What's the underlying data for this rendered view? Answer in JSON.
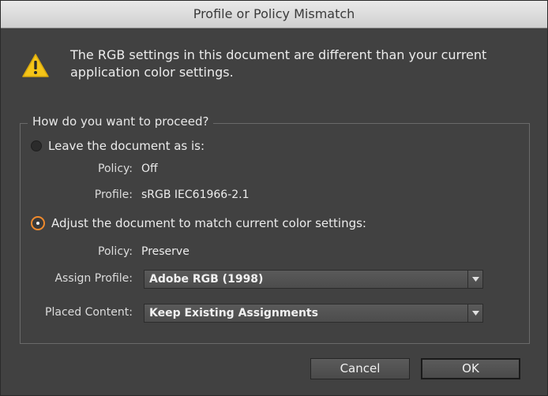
{
  "window": {
    "title": "Profile or Policy Mismatch"
  },
  "icons": {
    "warning": "warning-triangle-icon",
    "dropdown": "chevron-down-icon"
  },
  "message": "The RGB settings in this document are different than your current application color settings.",
  "group": {
    "legend": "How do you want to proceed?",
    "option1": {
      "label": "Leave the document as is:",
      "checked": false,
      "policy_label": "Policy:",
      "policy_value": "Off",
      "profile_label": "Profile:",
      "profile_value": "sRGB IEC61966-2.1"
    },
    "option2": {
      "label": "Adjust the document to match current color settings:",
      "checked": true,
      "policy_label": "Policy:",
      "policy_value": "Preserve",
      "assign_profile_label": "Assign Profile:",
      "assign_profile_value": "Adobe RGB (1998)",
      "placed_content_label": "Placed Content:",
      "placed_content_value": "Keep Existing Assignments"
    }
  },
  "buttons": {
    "cancel": "Cancel",
    "ok": "OK"
  },
  "colors": {
    "accent": "#f08a2c",
    "warning": "#f5c518",
    "background": "#414141"
  }
}
